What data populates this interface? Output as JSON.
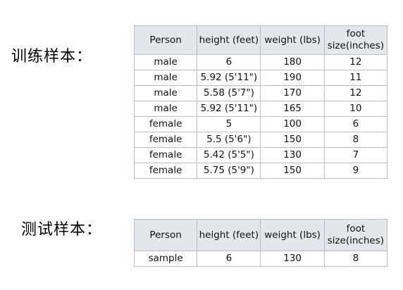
{
  "train": {
    "label": "训练样本：",
    "headers": [
      "Person",
      "height (feet)",
      "weight (lbs)",
      "foot size(inches)"
    ],
    "rows": [
      [
        "male",
        "6",
        "180",
        "12"
      ],
      [
        "male",
        "5.92 (5'11\")",
        "190",
        "11"
      ],
      [
        "male",
        "5.58 (5'7\")",
        "170",
        "12"
      ],
      [
        "male",
        "5.92 (5'11\")",
        "165",
        "10"
      ],
      [
        "female",
        "5",
        "100",
        "6"
      ],
      [
        "female",
        "5.5 (5'6\")",
        "150",
        "8"
      ],
      [
        "female",
        "5.42 (5'5\")",
        "130",
        "7"
      ],
      [
        "female",
        "5.75 (5'9\")",
        "150",
        "9"
      ]
    ]
  },
  "test": {
    "label": "测试样本：",
    "headers": [
      "Person",
      "height (feet)",
      "weight (lbs)",
      "foot size(inches)"
    ],
    "rows": [
      [
        "sample",
        "6",
        "130",
        "8"
      ]
    ]
  },
  "colors": {
    "header_bg": "#e4e6ea",
    "border": "#b8bcc4"
  }
}
